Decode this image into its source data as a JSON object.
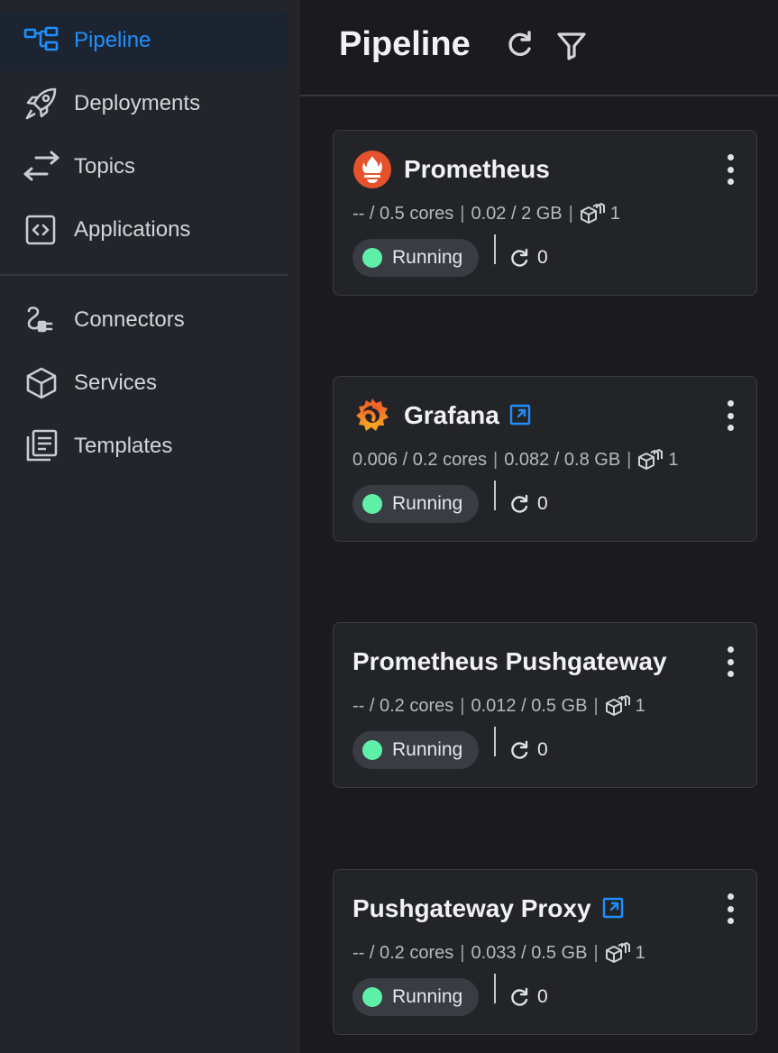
{
  "colors": {
    "accent": "#1e8fff",
    "running": "#5ef0a6",
    "prometheus": "#e6522c",
    "grafana": "#f27b21"
  },
  "sidebar": {
    "items": [
      {
        "label": "Pipeline",
        "icon": "pipeline-icon",
        "active": true
      },
      {
        "label": "Deployments",
        "icon": "rocket-icon"
      },
      {
        "label": "Topics",
        "icon": "arrows-exchange-icon"
      },
      {
        "label": "Applications",
        "icon": "code-box-icon"
      },
      {
        "label": "Connectors",
        "icon": "connector-icon"
      },
      {
        "label": "Services",
        "icon": "cube-icon"
      },
      {
        "label": "Templates",
        "icon": "templates-icon"
      }
    ]
  },
  "header": {
    "title": "Pipeline",
    "refresh_icon": "refresh-icon",
    "filter_icon": "filter-icon"
  },
  "cards": [
    {
      "name": "Prometheus",
      "logo": "prometheus-logo",
      "external": false,
      "cpu": "-- / 0.5 cores",
      "mem": "0.02 / 2 GB",
      "replicas": "1",
      "status": "Running",
      "restarts": "0"
    },
    {
      "name": "Grafana",
      "logo": "grafana-logo",
      "external": true,
      "cpu": "0.006 / 0.2 cores",
      "mem": "0.082 / 0.8 GB",
      "replicas": "1",
      "status": "Running",
      "restarts": "0"
    },
    {
      "name": "Prometheus Pushgateway",
      "logo": "",
      "external": false,
      "cpu": "-- / 0.2 cores",
      "mem": "0.012 / 0.5 GB",
      "replicas": "1",
      "status": "Running",
      "restarts": "0"
    },
    {
      "name": "Pushgateway Proxy",
      "logo": "",
      "external": true,
      "cpu": "-- / 0.2 cores",
      "mem": "0.033 / 0.5 GB",
      "replicas": "1",
      "status": "Running",
      "restarts": "0"
    }
  ],
  "separator": "|"
}
